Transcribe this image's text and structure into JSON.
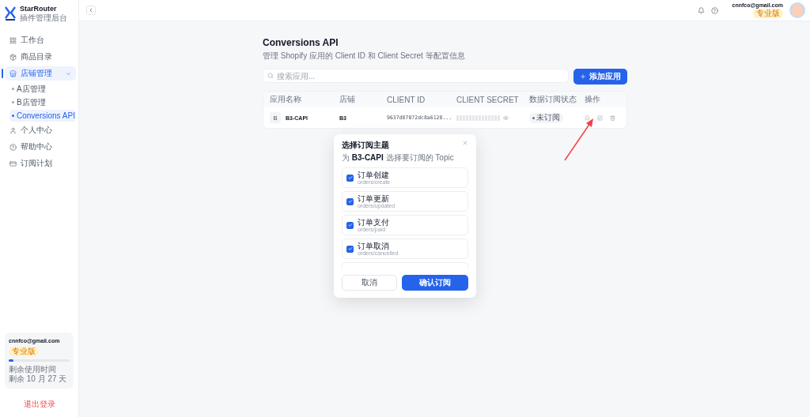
{
  "brand": {
    "name": "StarRouter",
    "subtitle": "插件管理后台"
  },
  "nav": [
    {
      "label": "工作台",
      "selected": false
    },
    {
      "label": "商品目录",
      "selected": false
    },
    {
      "label": "店铺管理",
      "selected": true,
      "expanded": true,
      "children": [
        {
          "label": "A店管理",
          "selected": false
        },
        {
          "label": "B店管理",
          "selected": false
        },
        {
          "label": "Conversions API",
          "selected": true
        }
      ]
    },
    {
      "label": "个人中心",
      "selected": false
    },
    {
      "label": "帮助中心",
      "selected": false
    },
    {
      "label": "订阅计划",
      "selected": false
    }
  ],
  "account": {
    "email": "cnnfco@gmail.com",
    "plan": "专业版",
    "level": 0.08,
    "remaining_label": "剩余使用时间",
    "remaining": "剩余 10 月 27 天",
    "logout": "退出登录"
  },
  "header": {
    "email": "cnnfco@gmail.com",
    "plan": "专业版"
  },
  "page": {
    "title": "Conversions API",
    "subtitle": "管理 Shopify 应用的 Client ID 和 Client Secret 等配置信息",
    "search": {
      "placeholder": "搜索应用..."
    },
    "add_button": "添加应用",
    "table": {
      "columns": [
        "应用名称",
        "店铺",
        "CLIENT ID",
        "CLIENT SECRET",
        "数据订阅状态",
        "操作"
      ],
      "rows": [
        {
          "initial": "B",
          "name": "B3-CAPI",
          "store": "B3",
          "client_id": "9637d87072dc8a6128...",
          "status": "未订阅"
        }
      ]
    }
  },
  "modal": {
    "title": "选择订阅主题",
    "subtitle": "为 **B3-CAPI** 选择要订阅的 Topic",
    "topics": [
      {
        "label": "订单创建",
        "topic": "orders/create",
        "checked": true
      },
      {
        "label": "订单更新",
        "topic": "orders/updated",
        "checked": true
      },
      {
        "label": "订单支付",
        "topic": "orders/paid",
        "checked": true
      },
      {
        "label": "订单取消",
        "topic": "orders/cancelled",
        "checked": true
      }
    ],
    "cancel": "取消",
    "confirm": "确认订阅"
  }
}
